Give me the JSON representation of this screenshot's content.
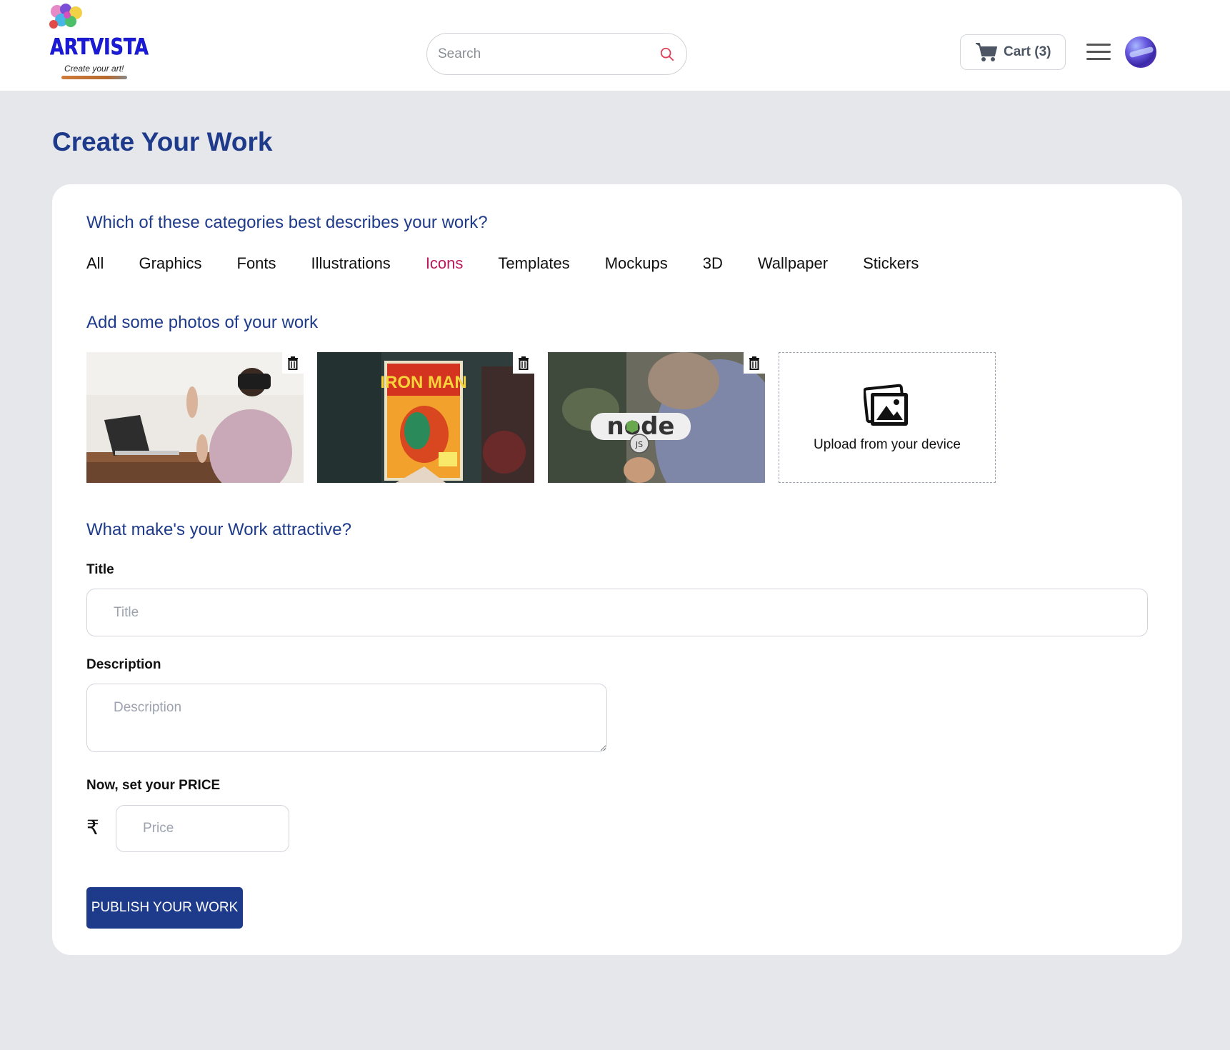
{
  "brand": {
    "name": "ARTVISTA",
    "tagline": "Create your art!"
  },
  "search": {
    "placeholder": "Search"
  },
  "cart": {
    "label": "Cart (3)"
  },
  "page": {
    "title": "Create Your Work"
  },
  "categories": {
    "heading": "Which of these categories best describes your work?",
    "items": [
      "All",
      "Graphics",
      "Fonts",
      "Illustrations",
      "Icons",
      "Templates",
      "Mockups",
      "3D",
      "Wallpaper",
      "Stickers"
    ],
    "selected": "Icons"
  },
  "photos": {
    "heading": "Add some photos of your work",
    "upload_label": "Upload from your device"
  },
  "form": {
    "heading": "What make's your Work attractive?",
    "title_label": "Title",
    "title_placeholder": "Title",
    "description_label": "Description",
    "description_placeholder": "Description",
    "price_label": "Now, set your PRICE",
    "currency_symbol": "₹",
    "price_placeholder": "Price",
    "publish_label": "PUBLISH YOUR WORK"
  },
  "colors": {
    "primary": "#1e3a8a",
    "active_category": "#be185d",
    "page_background": "#e5e7eb"
  }
}
